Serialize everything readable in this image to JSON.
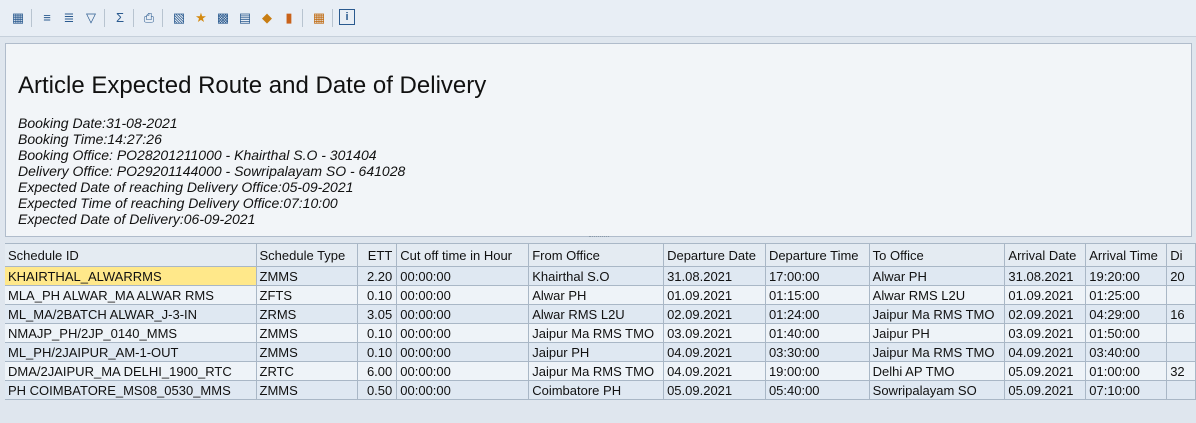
{
  "toolbar": {
    "icons": [
      "details-icon",
      "sort-asc-icon",
      "sort-desc-icon",
      "filter-icon",
      "sum-icon",
      "print-icon",
      "export-icon",
      "graphic-icon",
      "layout-icon",
      "abc-icon",
      "excel-icon",
      "chart-icon",
      "grid-icon",
      "info-icon"
    ]
  },
  "header": {
    "title": "Article Expected Route and Date of Delivery",
    "lines": [
      "Booking Date:31-08-2021",
      "Booking Time:14:27:26",
      "Booking Office: PO28201211000 - Khairthal S.O - 301404",
      "Delivery Office: PO29201144000 - Sowripalayam SO - 641028",
      "Expected Date of reaching Delivery Office:05-09-2021",
      "Expected Time of reaching Delivery Office:07:10:00",
      "Expected Date of Delivery:06-09-2021"
    ]
  },
  "table": {
    "columns": [
      "Schedule ID",
      "Schedule Type",
      "ETT",
      "Cut off time in Hour",
      "From Office",
      "Departure Date",
      "Departure Time",
      "To Office",
      "Arrival Date",
      "Arrival Time",
      "Di"
    ],
    "rows": [
      [
        "KHAIRTHAL_ALWARRMS",
        "ZMMS",
        "2.20",
        "00:00:00",
        "Khairthal S.O",
        "31.08.2021",
        "17:00:00",
        "Alwar PH",
        "31.08.2021",
        "19:20:00",
        "20"
      ],
      [
        "MLA_PH ALWAR_MA ALWAR RMS",
        "ZFTS",
        "0.10",
        "00:00:00",
        "Alwar PH",
        "01.09.2021",
        "01:15:00",
        "Alwar RMS  L2U",
        "01.09.2021",
        "01:25:00",
        ""
      ],
      [
        "ML_MA/2BATCH ALWAR_J-3-IN",
        "ZRMS",
        "3.05",
        "00:00:00",
        "Alwar RMS  L2U",
        "02.09.2021",
        "01:24:00",
        "Jaipur Ma RMS TMO",
        "02.09.2021",
        "04:29:00",
        "16"
      ],
      [
        "NMAJP_PH/2JP_0140_MMS",
        "ZMMS",
        "0.10",
        "00:00:00",
        "Jaipur Ma RMS TMO",
        "03.09.2021",
        "01:40:00",
        "Jaipur PH",
        "03.09.2021",
        "01:50:00",
        ""
      ],
      [
        "ML_PH/2JAIPUR_AM-1-OUT",
        "ZMMS",
        "0.10",
        "00:00:00",
        "Jaipur PH",
        "04.09.2021",
        "03:30:00",
        "Jaipur Ma RMS TMO",
        "04.09.2021",
        "03:40:00",
        ""
      ],
      [
        "DMA/2JAIPUR_MA DELHI_1900_RTC",
        "ZRTC",
        "6.00",
        "00:00:00",
        "Jaipur Ma RMS TMO",
        "04.09.2021",
        "19:00:00",
        "Delhi AP TMO",
        "05.09.2021",
        "01:00:00",
        "32"
      ],
      [
        "PH COIMBATORE_MS08_0530_MMS",
        "ZMMS",
        "0.50",
        "00:00:00",
        "Coimbatore PH",
        "05.09.2021",
        "05:40:00",
        "Sowripalayam SO",
        "05.09.2021",
        "07:10:00",
        ""
      ]
    ]
  }
}
